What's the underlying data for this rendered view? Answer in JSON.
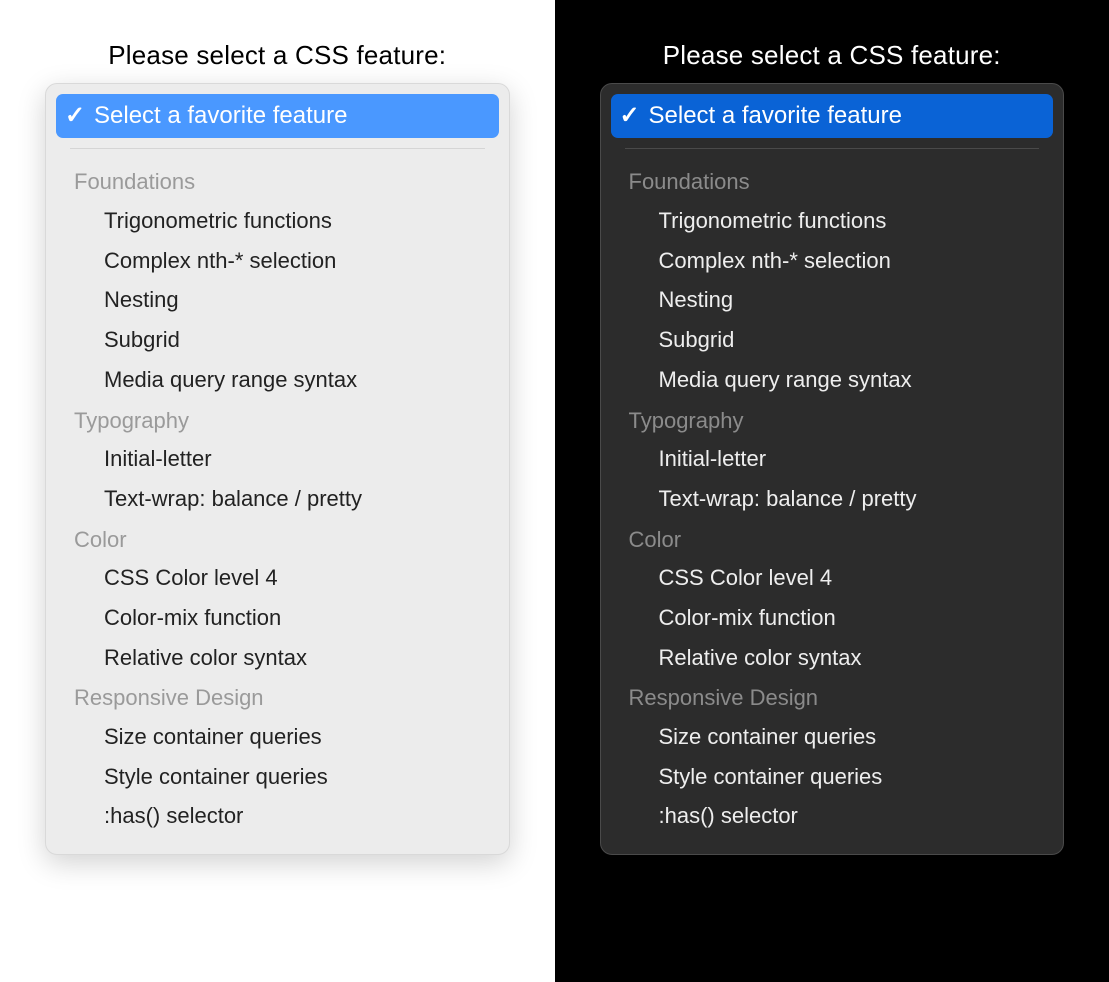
{
  "prompt_label": "Please select a CSS feature:",
  "selected_label": "Select a favorite feature",
  "colors": {
    "light_accent": "#4a98ff",
    "dark_accent": "#0a63d6"
  },
  "groups": [
    {
      "label": "Foundations",
      "options": [
        "Trigonometric functions",
        "Complex nth-* selection",
        "Nesting",
        "Subgrid",
        "Media query range syntax"
      ]
    },
    {
      "label": "Typography",
      "options": [
        "Initial-letter",
        "Text-wrap: balance / pretty"
      ]
    },
    {
      "label": "Color",
      "options": [
        "CSS Color level 4",
        "Color-mix function",
        "Relative color syntax"
      ]
    },
    {
      "label": "Responsive Design",
      "options": [
        "Size container queries",
        "Style container queries",
        ":has() selector"
      ]
    }
  ]
}
